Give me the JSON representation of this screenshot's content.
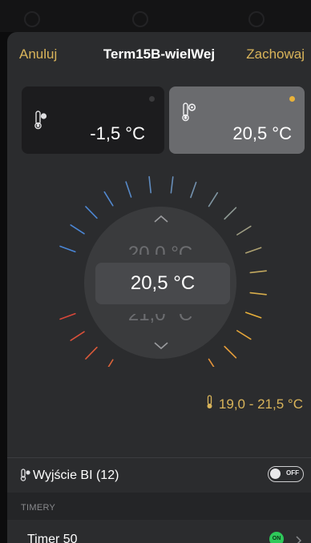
{
  "header": {
    "cancel_label": "Anuluj",
    "title": "Term15B-wielWej",
    "save_label": "Zachowaj"
  },
  "cards": {
    "current": {
      "value": "-1,5 °C",
      "icon": "thermometer-icon",
      "active": false
    },
    "setpoint": {
      "value": "20,5 °C",
      "icon": "thermometer-setpoint-icon",
      "active": true
    }
  },
  "dial": {
    "prev_value": "20,0 °C",
    "selected_value": "20,5 °C",
    "next_value": "21,0 °C",
    "cold_color": "#4a86d6",
    "warm_color": "#e8b23a",
    "hot_color": "#d9473a"
  },
  "range": {
    "text": "19,0 - 21,5 °C",
    "icon": "thermometer-icon"
  },
  "output": {
    "label": "Wyjście BI (12)",
    "icon": "thermometer-output-icon",
    "toggle_label": "OFF",
    "toggle_on": false
  },
  "timers": {
    "section_title": "TIMERY",
    "items": [
      {
        "name": "Timer 50",
        "status": "ON"
      }
    ]
  },
  "colors": {
    "accent": "#d9b45a",
    "sheet_bg": "#2b2c2e",
    "on_green": "#2ec85a"
  }
}
